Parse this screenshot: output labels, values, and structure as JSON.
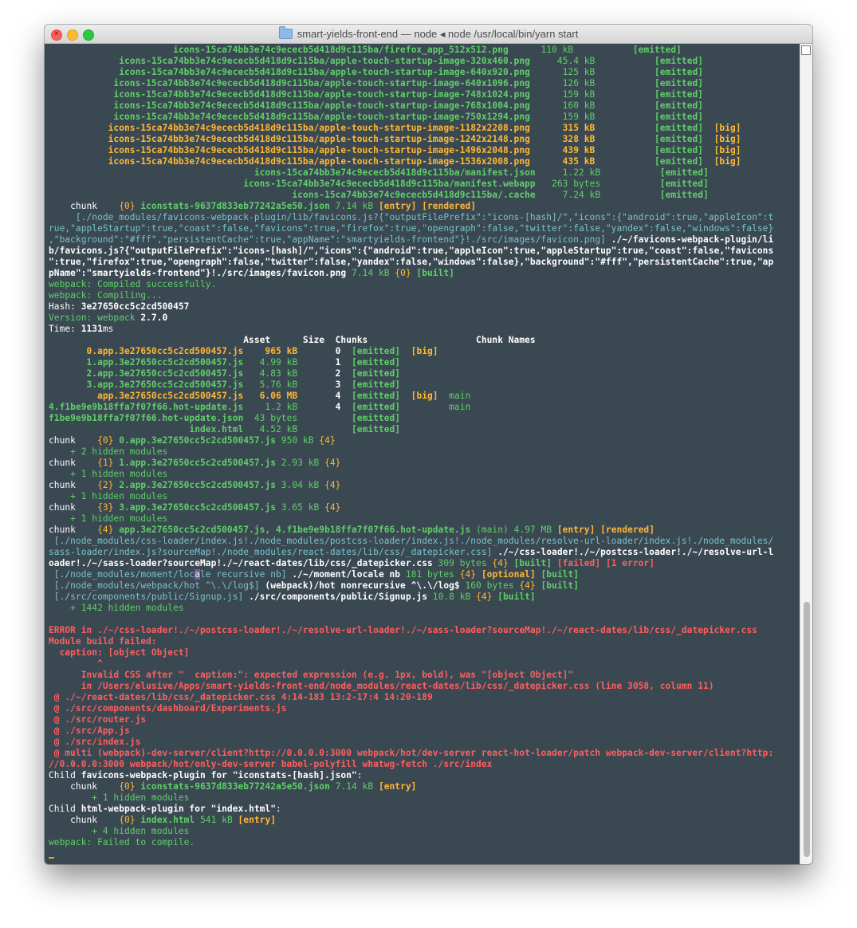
{
  "window": {
    "title": "smart-yields-front-end — node ◂ node /usr/local/bin/yarn start",
    "close_glyph": "×"
  },
  "colors": {
    "green": "#5fd068",
    "bold_green": "#4fdc5f",
    "yellow": "#ffb833",
    "red": "#ff5f5f",
    "cyan": "#7bc2c9",
    "white": "#ffffff",
    "dim": "#b5c7c9"
  },
  "terminal": {
    "lines": [
      [
        [
          "                       icons-15ca74bb3e74c9ececb5d418d9c115ba/firefox_app_512x512.png",
          "g",
          1
        ],
        [
          "      110 kB           ",
          "g",
          0
        ],
        [
          "[emitted]",
          "g",
          1
        ]
      ],
      [
        [
          "             icons-15ca74bb3e74c9ececb5d418d9c115ba/apple-touch-startup-image-320x460.png",
          "g",
          1
        ],
        [
          "     45.4 kB           ",
          "g",
          0
        ],
        [
          "[emitted]",
          "g",
          1
        ]
      ],
      [
        [
          "             icons-15ca74bb3e74c9ececb5d418d9c115ba/apple-touch-startup-image-640x920.png",
          "g",
          1
        ],
        [
          "      125 kB           ",
          "g",
          0
        ],
        [
          "[emitted]",
          "g",
          1
        ]
      ],
      [
        [
          "            icons-15ca74bb3e74c9ececb5d418d9c115ba/apple-touch-startup-image-640x1096.png",
          "g",
          1
        ],
        [
          "      126 kB           ",
          "g",
          0
        ],
        [
          "[emitted]",
          "g",
          1
        ]
      ],
      [
        [
          "            icons-15ca74bb3e74c9ececb5d418d9c115ba/apple-touch-startup-image-748x1024.png",
          "g",
          1
        ],
        [
          "      159 kB           ",
          "g",
          0
        ],
        [
          "[emitted]",
          "g",
          1
        ]
      ],
      [
        [
          "            icons-15ca74bb3e74c9ececb5d418d9c115ba/apple-touch-startup-image-768x1004.png",
          "g",
          1
        ],
        [
          "      160 kB           ",
          "g",
          0
        ],
        [
          "[emitted]",
          "g",
          1
        ]
      ],
      [
        [
          "            icons-15ca74bb3e74c9ececb5d418d9c115ba/apple-touch-startup-image-750x1294.png",
          "g",
          1
        ],
        [
          "      159 kB           ",
          "g",
          0
        ],
        [
          "[emitted]",
          "g",
          1
        ]
      ],
      [
        [
          "           icons-15ca74bb3e74c9ececb5d418d9c115ba/apple-touch-startup-image-1182x2208.png",
          "y",
          1
        ],
        [
          "      315 kB           ",
          "y",
          1
        ],
        [
          "[emitted]",
          "g",
          1
        ],
        [
          "  ",
          "w",
          0
        ],
        [
          "[big]",
          "y",
          1
        ]
      ],
      [
        [
          "           icons-15ca74bb3e74c9ececb5d418d9c115ba/apple-touch-startup-image-1242x2148.png",
          "y",
          1
        ],
        [
          "      328 kB           ",
          "y",
          1
        ],
        [
          "[emitted]",
          "g",
          1
        ],
        [
          "  ",
          "w",
          0
        ],
        [
          "[big]",
          "y",
          1
        ]
      ],
      [
        [
          "           icons-15ca74bb3e74c9ececb5d418d9c115ba/apple-touch-startup-image-1496x2048.png",
          "y",
          1
        ],
        [
          "      439 kB           ",
          "y",
          1
        ],
        [
          "[emitted]",
          "g",
          1
        ],
        [
          "  ",
          "w",
          0
        ],
        [
          "[big]",
          "y",
          1
        ]
      ],
      [
        [
          "           icons-15ca74bb3e74c9ececb5d418d9c115ba/apple-touch-startup-image-1536x2008.png",
          "y",
          1
        ],
        [
          "      435 kB           ",
          "y",
          1
        ],
        [
          "[emitted]",
          "g",
          1
        ],
        [
          "  ",
          "w",
          0
        ],
        [
          "[big]",
          "y",
          1
        ]
      ],
      [
        [
          "                                      icons-15ca74bb3e74c9ececb5d418d9c115ba/manifest.json",
          "g",
          1
        ],
        [
          "     1.22 kB           ",
          "g",
          0
        ],
        [
          "[emitted]",
          "g",
          1
        ]
      ],
      [
        [
          "                                    icons-15ca74bb3e74c9ececb5d418d9c115ba/manifest.webapp",
          "g",
          1
        ],
        [
          "   263 bytes           ",
          "g",
          0
        ],
        [
          "[emitted]",
          "g",
          1
        ]
      ],
      [
        [
          "                                             icons-15ca74bb3e74c9ececb5d418d9c115ba/.cache",
          "g",
          1
        ],
        [
          "     7.24 kB           ",
          "g",
          0
        ],
        [
          "[emitted]",
          "g",
          1
        ]
      ],
      [
        [
          "    chunk    ",
          "w",
          0
        ],
        [
          "{0}",
          "y",
          0
        ],
        [
          " iconstats-9637d833eb77242a5e50.json ",
          "g",
          1
        ],
        [
          "7.14 kB ",
          "g",
          0
        ],
        [
          "[entry] [rendered]",
          "y",
          1
        ]
      ],
      [
        [
          "     [./node_modules/favicons-webpack-plugin/lib/favicons.js?{\"outputFilePrefix\":\"icons-[hash]/\",\"icons\":{\"android\":true,\"appleIcon\":t",
          "c",
          0
        ]
      ],
      [
        [
          "rue,\"appleStartup\":true,\"coast\":false,\"favicons\":true,\"firefox\":true,\"opengraph\":false,\"twitter\":false,\"yandex\":false,\"windows\":false}",
          "c",
          0
        ]
      ],
      [
        [
          ",\"background\":\"#fff\",\"persistentCache\":true,\"appName\":\"smartyields-frontend\"}!./src/images/favicon.png]",
          "c",
          0
        ],
        [
          " ./~/favicons-webpack-plugin/li",
          "w",
          1
        ]
      ],
      [
        [
          "b/favicons.js?{\"outputFilePrefix\":\"icons-[hash]/\",\"icons\":{\"android\":true,\"appleIcon\":true,\"appleStartup\":true,\"coast\":false,\"favicons",
          "w",
          1
        ]
      ],
      [
        [
          "\":true,\"firefox\":true,\"opengraph\":false,\"twitter\":false,\"yandex\":false,\"windows\":false},\"background\":\"#fff\",\"persistentCache\":true,\"ap",
          "w",
          1
        ]
      ],
      [
        [
          "pName\":\"smartyields-frontend\"}!./src/images/favicon.png",
          "w",
          1
        ],
        [
          " 7.14 kB ",
          "g",
          0
        ],
        [
          "{0}",
          "y",
          0
        ],
        [
          " [built]",
          "g",
          1
        ]
      ],
      [
        [
          "webpack: Compiled successfully.",
          "g",
          0
        ]
      ],
      [
        [
          "webpack: Compiling...",
          "g",
          0
        ]
      ],
      [
        [
          "Hash: ",
          "w",
          0
        ],
        [
          "3e27650cc5c2cd500457",
          "w",
          1
        ]
      ],
      [
        [
          "Version: webpack ",
          "g",
          0
        ],
        [
          "2.7.0",
          "w",
          1
        ]
      ],
      [
        [
          "Time: ",
          "w",
          0
        ],
        [
          "1131",
          "w",
          1
        ],
        [
          "ms",
          "w",
          0
        ]
      ],
      [
        [
          "                                    Asset      Size  Chunks                    Chunk Names",
          "w",
          1
        ]
      ],
      [
        [
          "       ",
          "w",
          0
        ],
        [
          "0.app.3e27650cc5c2cd500457.js",
          "y",
          1
        ],
        [
          "    965 kB ",
          "y",
          1
        ],
        [
          "      0  ",
          "w",
          1
        ],
        [
          "[emitted]",
          "g",
          1
        ],
        [
          "  ",
          "w",
          0
        ],
        [
          "[big]",
          "y",
          1
        ]
      ],
      [
        [
          "       1.app.3e27650cc5c2cd500457.js",
          "g",
          1
        ],
        [
          "   4.99 kB ",
          "g",
          0
        ],
        [
          "      1  ",
          "w",
          1
        ],
        [
          "[emitted]",
          "g",
          1
        ]
      ],
      [
        [
          "       2.app.3e27650cc5c2cd500457.js",
          "g",
          1
        ],
        [
          "   4.83 kB ",
          "g",
          0
        ],
        [
          "      2  ",
          "w",
          1
        ],
        [
          "[emitted]",
          "g",
          1
        ]
      ],
      [
        [
          "       3.app.3e27650cc5c2cd500457.js",
          "g",
          1
        ],
        [
          "   5.76 kB ",
          "g",
          0
        ],
        [
          "      3  ",
          "w",
          1
        ],
        [
          "[emitted]",
          "g",
          1
        ]
      ],
      [
        [
          "         app.3e27650cc5c2cd500457.js",
          "y",
          1
        ],
        [
          "   6.06 MB ",
          "y",
          1
        ],
        [
          "      4  ",
          "w",
          1
        ],
        [
          "[emitted]",
          "g",
          1
        ],
        [
          "  ",
          "w",
          0
        ],
        [
          "[big]",
          "y",
          1
        ],
        [
          "  main",
          "g",
          0
        ]
      ],
      [
        [
          "4.f1be9e9b18ffa7f07f66.hot-update.js",
          "g",
          1
        ],
        [
          "    1.2 kB ",
          "g",
          0
        ],
        [
          "      4  ",
          "w",
          1
        ],
        [
          "[emitted]",
          "g",
          1
        ],
        [
          "         main",
          "g",
          0
        ]
      ],
      [
        [
          "f1be9e9b18ffa7f07f66.hot-update.json",
          "g",
          1
        ],
        [
          "  43 bytes ",
          "g",
          0
        ],
        [
          "         ",
          "w",
          0
        ],
        [
          "[emitted]",
          "g",
          1
        ]
      ],
      [
        [
          "                          index.html",
          "g",
          1
        ],
        [
          "   4.52 kB ",
          "g",
          0
        ],
        [
          "         ",
          "w",
          0
        ],
        [
          "[emitted]",
          "g",
          1
        ]
      ],
      [
        [
          "chunk    ",
          "w",
          0
        ],
        [
          "{0}",
          "y",
          0
        ],
        [
          " 0.app.3e27650cc5c2cd500457.js ",
          "g",
          1
        ],
        [
          "950 kB ",
          "g",
          0
        ],
        [
          "{4}",
          "y",
          0
        ]
      ],
      [
        [
          "    + 2 hidden modules",
          "g",
          0
        ]
      ],
      [
        [
          "chunk    ",
          "w",
          0
        ],
        [
          "{1}",
          "y",
          0
        ],
        [
          " 1.app.3e27650cc5c2cd500457.js ",
          "g",
          1
        ],
        [
          "2.93 kB ",
          "g",
          0
        ],
        [
          "{4}",
          "y",
          0
        ]
      ],
      [
        [
          "    + 1 hidden modules",
          "g",
          0
        ]
      ],
      [
        [
          "chunk    ",
          "w",
          0
        ],
        [
          "{2}",
          "y",
          0
        ],
        [
          " 2.app.3e27650cc5c2cd500457.js ",
          "g",
          1
        ],
        [
          "3.04 kB ",
          "g",
          0
        ],
        [
          "{4}",
          "y",
          0
        ]
      ],
      [
        [
          "    + 1 hidden modules",
          "g",
          0
        ]
      ],
      [
        [
          "chunk    ",
          "w",
          0
        ],
        [
          "{3}",
          "y",
          0
        ],
        [
          " 3.app.3e27650cc5c2cd500457.js ",
          "g",
          1
        ],
        [
          "3.65 kB ",
          "g",
          0
        ],
        [
          "{4}",
          "y",
          0
        ]
      ],
      [
        [
          "    + 1 hidden modules",
          "g",
          0
        ]
      ],
      [
        [
          "chunk    ",
          "w",
          0
        ],
        [
          "{4}",
          "y",
          0
        ],
        [
          " app.3e27650cc5c2cd500457.js, 4.f1be9e9b18ffa7f07f66.hot-update.js ",
          "g",
          1
        ],
        [
          "(main) ",
          "g",
          0
        ],
        [
          "4.97 MB ",
          "g",
          0
        ],
        [
          "[entry] [rendered]",
          "y",
          1
        ]
      ],
      [
        [
          " [./node_modules/css-loader/index.js!./node_modules/postcss-loader/index.js!./node_modules/resolve-url-loader/index.js!./node_modules/",
          "c",
          0
        ]
      ],
      [
        [
          "sass-loader/index.js?sourceMap!./node_modules/react-dates/lib/css/_datepicker.css]",
          "c",
          0
        ],
        [
          " ./~/css-loader!./~/postcss-loader!./~/resolve-url-l",
          "w",
          1
        ]
      ],
      [
        [
          "oader!./~/sass-loader?sourceMap!./~/react-dates/lib/css/_datepicker.css",
          "w",
          1
        ],
        [
          " 309 bytes ",
          "g",
          0
        ],
        [
          "{4}",
          "y",
          0
        ],
        [
          " [built]",
          "g",
          1
        ],
        [
          " [failed]",
          "r",
          1
        ],
        [
          " [1 error]",
          "r",
          1
        ]
      ],
      [
        [
          " [./node_modules/moment/loc",
          "c",
          0
        ],
        [
          "a",
          "hl",
          0
        ],
        [
          "le recursive nb]",
          "c",
          0
        ],
        [
          " ./~/moment/locale nb",
          "w",
          1
        ],
        [
          " 181 bytes ",
          "g",
          0
        ],
        [
          "{4}",
          "y",
          0
        ],
        [
          " [optional]",
          "y",
          1
        ],
        [
          " [built]",
          "g",
          1
        ]
      ],
      [
        [
          " [./node_modules/webpack/hot ^\\.\\/log$]",
          "c",
          0
        ],
        [
          " (webpack)/hot nonrecursive ^\\.\\/log$",
          "w",
          1
        ],
        [
          " 160 bytes ",
          "g",
          0
        ],
        [
          "{4}",
          "y",
          0
        ],
        [
          " [built]",
          "g",
          1
        ]
      ],
      [
        [
          " [./src/components/public/Signup.js]",
          "c",
          0
        ],
        [
          " ./src/components/public/Signup.js",
          "w",
          1
        ],
        [
          " 10.8 kB ",
          "g",
          0
        ],
        [
          "{4}",
          "y",
          0
        ],
        [
          " [built]",
          "g",
          1
        ]
      ],
      [
        [
          "    + 1442 hidden modules",
          "g",
          0
        ]
      ],
      [
        [
          "",
          "w",
          0
        ]
      ],
      [
        [
          "ERROR in ./~/css-loader!./~/postcss-loader!./~/resolve-url-loader!./~/sass-loader?sourceMap!./~/react-dates/lib/css/_datepicker.css",
          "r",
          1
        ]
      ],
      [
        [
          "Module build failed:",
          "r",
          1
        ]
      ],
      [
        [
          "  caption: [object Object]",
          "r",
          1
        ]
      ],
      [
        [
          "         ^",
          "r",
          1
        ]
      ],
      [
        [
          "      Invalid CSS after \"  caption:\": expected expression (e.g. 1px, bold), was \"[object Object]\"",
          "r",
          1
        ]
      ],
      [
        [
          "      in /Users/elusive/Apps/smart-yields-front-end/node_modules/react-dates/lib/css/_datepicker.css (line 3058, column 11)",
          "r",
          1
        ]
      ],
      [
        [
          " @ ./~/react-dates/lib/css/_datepicker.css 4:14-183 13:2-17:4 14:20-189",
          "r",
          1
        ]
      ],
      [
        [
          " @ ./src/components/dashboard/Experiments.js",
          "r",
          1
        ]
      ],
      [
        [
          " @ ./src/router.js",
          "r",
          1
        ]
      ],
      [
        [
          " @ ./src/App.js",
          "r",
          1
        ]
      ],
      [
        [
          " @ ./src/index.js",
          "r",
          1
        ]
      ],
      [
        [
          " @ multi (webpack)-dev-server/client?http://0.0.0.0:3000 webpack/hot/dev-server react-hot-loader/patch webpack-dev-server/client?http:",
          "r",
          1
        ]
      ],
      [
        [
          "//0.0.0.0:3000 webpack/hot/only-dev-server babel-polyfill whatwg-fetch ./src/index",
          "r",
          1
        ]
      ],
      [
        [
          "Child ",
          "w",
          0
        ],
        [
          "favicons-webpack-plugin for \"iconstats-[hash].json\"",
          "w",
          1
        ],
        [
          ":",
          "w",
          0
        ]
      ],
      [
        [
          "    chunk    ",
          "w",
          0
        ],
        [
          "{0}",
          "y",
          0
        ],
        [
          " iconstats-9637d833eb77242a5e50.json ",
          "g",
          1
        ],
        [
          "7.14 kB ",
          "g",
          0
        ],
        [
          "[entry]",
          "y",
          1
        ]
      ],
      [
        [
          "        + 1 hidden modules",
          "g",
          0
        ]
      ],
      [
        [
          "Child ",
          "w",
          0
        ],
        [
          "html-webpack-plugin for \"index.html\"",
          "w",
          1
        ],
        [
          ":",
          "w",
          0
        ]
      ],
      [
        [
          "    chunk    ",
          "w",
          0
        ],
        [
          "{0}",
          "y",
          0
        ],
        [
          " index.html ",
          "g",
          1
        ],
        [
          "541 kB ",
          "g",
          0
        ],
        [
          "[entry]",
          "y",
          1
        ]
      ],
      [
        [
          "        + 4 hidden modules",
          "g",
          0
        ]
      ],
      [
        [
          "webpack: Failed to compile.",
          "g",
          0
        ]
      ]
    ]
  }
}
